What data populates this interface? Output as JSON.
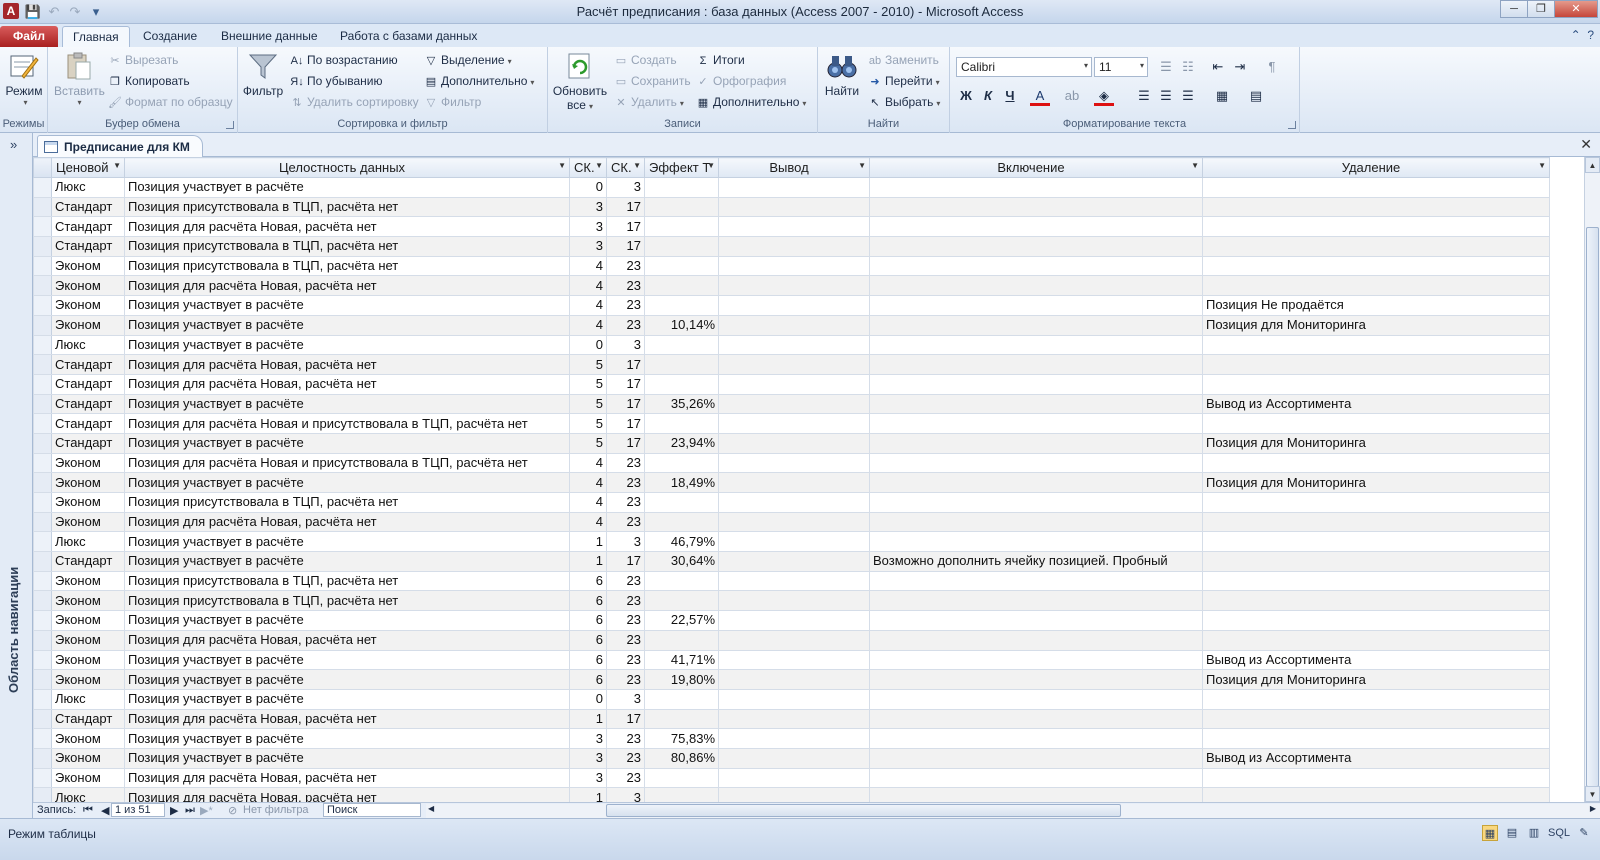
{
  "window": {
    "title": "Расчёт предписания : база данных (Access 2007 - 2010)  -  Microsoft Access",
    "app_letter": "A",
    "min": "─",
    "max": "❐",
    "close": "✕"
  },
  "ribbon_tabs": [
    {
      "label": "Файл"
    },
    {
      "label": "Главная"
    },
    {
      "label": "Создание"
    },
    {
      "label": "Внешние данные"
    },
    {
      "label": "Работа с базами данных"
    }
  ],
  "ribbon": {
    "views": {
      "mode": "Режим",
      "group": "Режимы"
    },
    "clipboard": {
      "paste": "Вставить",
      "cut": "Вырезать",
      "copy": "Копировать",
      "format_painter": "Формат по образцу",
      "group": "Буфер обмена"
    },
    "sort_filter": {
      "filter": "Фильтр",
      "asc": "По возрастанию",
      "desc": "По убыванию",
      "remove_sort": "Удалить сортировку",
      "selection": "Выделение",
      "advanced": "Дополнительно",
      "toggle_filter": "Фильтр",
      "group": "Сортировка и фильтр"
    },
    "records": {
      "refresh": "Обновить",
      "refresh2": "все",
      "new": "Создать",
      "save": "Сохранить",
      "delete": "Удалить",
      "totals": "Итоги",
      "spelling": "Орфография",
      "more": "Дополнительно",
      "group": "Записи"
    },
    "find": {
      "find": "Найти",
      "replace": "Заменить",
      "goto": "Перейти",
      "select": "Выбрать",
      "group": "Найти"
    },
    "text_format": {
      "font": "Calibri",
      "size": "11",
      "bold": "Ж",
      "italic": "К",
      "underline": "Ч",
      "group": "Форматирование текста"
    }
  },
  "nav_pane": {
    "label": "Область навигации",
    "toggle": "»"
  },
  "document_tab": {
    "label": "Предписание для КМ",
    "close": "✕"
  },
  "columns": [
    "Ценовой",
    "Целостность данных",
    "СК.",
    "СК.",
    "Эффект Т",
    "Вывод",
    "Включение",
    "Удаление"
  ],
  "rows": [
    [
      "Люкс",
      "Позиция участвует в расчёте",
      "0",
      "3",
      "",
      "",
      "",
      ""
    ],
    [
      "Стандарт",
      "Позиция присутствовала в ТЦП, расчёта нет",
      "3",
      "17",
      "",
      "",
      "",
      ""
    ],
    [
      "Стандарт",
      "Позиция для расчёта Новая, расчёта нет",
      "3",
      "17",
      "",
      "",
      "",
      ""
    ],
    [
      "Стандарт",
      "Позиция присутствовала в ТЦП, расчёта нет",
      "3",
      "17",
      "",
      "",
      "",
      ""
    ],
    [
      "Эконом",
      "Позиция присутствовала в ТЦП, расчёта нет",
      "4",
      "23",
      "",
      "",
      "",
      ""
    ],
    [
      "Эконом",
      "Позиция для расчёта Новая, расчёта нет",
      "4",
      "23",
      "",
      "",
      "",
      ""
    ],
    [
      "Эконом",
      "Позиция участвует в расчёте",
      "4",
      "23",
      "",
      "",
      "",
      "Позиция Не продаётся"
    ],
    [
      "Эконом",
      "Позиция участвует в расчёте",
      "4",
      "23",
      "10,14%",
      "",
      "",
      "Позиция для Мониторинга"
    ],
    [
      "Люкс",
      "Позиция участвует в расчёте",
      "0",
      "3",
      "",
      "",
      "",
      ""
    ],
    [
      "Стандарт",
      "Позиция для расчёта Новая, расчёта нет",
      "5",
      "17",
      "",
      "",
      "",
      ""
    ],
    [
      "Стандарт",
      "Позиция для расчёта Новая, расчёта нет",
      "5",
      "17",
      "",
      "",
      "",
      ""
    ],
    [
      "Стандарт",
      "Позиция участвует в расчёте",
      "5",
      "17",
      "35,26%",
      "",
      "",
      "Вывод из Ассортимента"
    ],
    [
      "Стандарт",
      "Позиция для расчёта Новая и присутствовала в ТЦП, расчёта нет",
      "5",
      "17",
      "",
      "",
      "",
      ""
    ],
    [
      "Стандарт",
      "Позиция участвует в расчёте",
      "5",
      "17",
      "23,94%",
      "",
      "",
      "Позиция для Мониторинга"
    ],
    [
      "Эконом",
      "Позиция для расчёта Новая и присутствовала в ТЦП, расчёта нет",
      "4",
      "23",
      "",
      "",
      "",
      ""
    ],
    [
      "Эконом",
      "Позиция участвует в расчёте",
      "4",
      "23",
      "18,49%",
      "",
      "",
      "Позиция для Мониторинга"
    ],
    [
      "Эконом",
      "Позиция присутствовала в ТЦП, расчёта нет",
      "4",
      "23",
      "",
      "",
      "",
      ""
    ],
    [
      "Эконом",
      "Позиция для расчёта Новая, расчёта нет",
      "4",
      "23",
      "",
      "",
      "",
      ""
    ],
    [
      "Люкс",
      "Позиция участвует в расчёте",
      "1",
      "3",
      "46,79%",
      "",
      "",
      ""
    ],
    [
      "Стандарт",
      "Позиция участвует в расчёте",
      "1",
      "17",
      "30,64%",
      "",
      "Возможно дополнить ячейку позицией. Пробный",
      ""
    ],
    [
      "Эконом",
      "Позиция присутствовала в ТЦП, расчёта нет",
      "6",
      "23",
      "",
      "",
      "",
      ""
    ],
    [
      "Эконом",
      "Позиция присутствовала в ТЦП, расчёта нет",
      "6",
      "23",
      "",
      "",
      "",
      ""
    ],
    [
      "Эконом",
      "Позиция участвует в расчёте",
      "6",
      "23",
      "22,57%",
      "",
      "",
      ""
    ],
    [
      "Эконом",
      "Позиция для расчёта Новая, расчёта нет",
      "6",
      "23",
      "",
      "",
      "",
      ""
    ],
    [
      "Эконом",
      "Позиция участвует в расчёте",
      "6",
      "23",
      "41,71%",
      "",
      "",
      "Вывод из Ассортимента"
    ],
    [
      "Эконом",
      "Позиция участвует в расчёте",
      "6",
      "23",
      "19,80%",
      "",
      "",
      "Позиция для Мониторинга"
    ],
    [
      "Люкс",
      "Позиция участвует в расчёте",
      "0",
      "3",
      "",
      "",
      "",
      ""
    ],
    [
      "Стандарт",
      "Позиция для расчёта Новая, расчёта нет",
      "1",
      "17",
      "",
      "",
      "",
      ""
    ],
    [
      "Эконом",
      "Позиция участвует в расчёте",
      "3",
      "23",
      "75,83%",
      "",
      "",
      ""
    ],
    [
      "Эконом",
      "Позиция участвует в расчёте",
      "3",
      "23",
      "80,86%",
      "",
      "",
      "Вывод из Ассортимента"
    ],
    [
      "Эконом",
      "Позиция для расчёта Новая, расчёта нет",
      "3",
      "23",
      "",
      "",
      "",
      ""
    ],
    [
      "Люкс",
      "Позиция для расчёта Новая, расчёта нет",
      "1",
      "3",
      "",
      "",
      "",
      ""
    ]
  ],
  "record_nav": {
    "label": "Запись:",
    "position": "1 из 51",
    "filter": "Нет фильтра",
    "search": "Поиск"
  },
  "status": {
    "text": "Режим таблицы",
    "sql": "SQL"
  }
}
